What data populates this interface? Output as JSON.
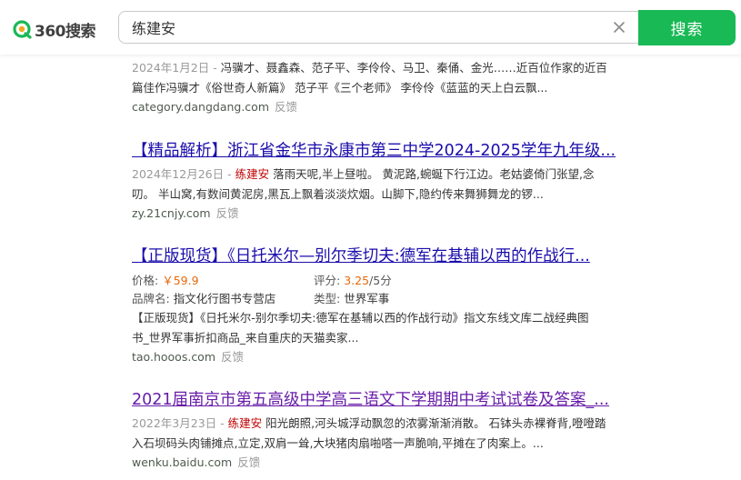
{
  "logo": {
    "text": "360搜索"
  },
  "search": {
    "query": "练建安"
  },
  "search_button_label": "搜索",
  "colors": {
    "accent": "#19b955",
    "link": "#1a0dab",
    "visited": "#681da8",
    "highlight": "#c00000",
    "price": "#e5690b"
  },
  "results": [
    {
      "date": "2024年1月2日",
      "separator": " - ",
      "desc_line1": "冯骥才、聂鑫森、范子平、李伶伶、马卫、秦俑、金光……近百位作家的近百",
      "desc_line2": "篇佳作冯骥才《俗世奇人新篇》 范子平《三个老师》 李伶伶《蓝蓝的天上白云飘...",
      "url": "category.dangdang.com",
      "feedback": "反馈"
    },
    {
      "title": "【精品解析】浙江省金华市永康市第三中学2024-2025学年九年级...",
      "date": "2024年12月26日",
      "separator": " - ",
      "highlight": "练建安",
      "desc_line1_rest": " 落雨天呢,半上昼啦。 黄泥路,蜿蜒下行江边。老姑婆倚门张望,念",
      "desc_line2": "叨。 半山窝,有数间黄泥房,黑瓦上飘着淡淡炊烟。山脚下,隐约传来舞狮舞龙的锣...",
      "url": "zy.21cnjy.com",
      "feedback": "反馈"
    },
    {
      "title": "【正版现货】《日托米尔—别尔季切夫:德军在基辅以西的作战行...",
      "price_label": "价格:",
      "price_value": "￥59.9",
      "score_label": "评分:",
      "score_value": "3.25",
      "score_total": "/5分",
      "brand_label": "品牌名:",
      "brand_value": "指文化行图书专营店",
      "type_label": "类型:",
      "type_value": "世界军事",
      "desc_line1": "【正版现货】《日托米尔-别尔季切夫:德军在基辅以西的作战行动》指文东线文库二战经典图",
      "desc_line2": "书_世界军事折扣商品_来自重庆的天猫卖家...",
      "url": "tao.hooos.com",
      "feedback": "反馈"
    },
    {
      "title": "2021届南京市第五高级中学高三语文下学期期中考试试卷及答案_...",
      "date": "2022年3月23日",
      "separator": " - ",
      "highlight": "练建安",
      "desc_line1_rest": " 阳光朗照,河头城浮动飘忽的浓雾渐渐消散。 石钵头赤裸脊背,噔噔踏",
      "desc_line2": "入石坝码头肉铺摊点,立定,双肩一耸,大块猪肉扇啪嗒一声脆响,平摊在了肉案上。...",
      "url": "wenku.baidu.com",
      "feedback": "反馈"
    }
  ]
}
